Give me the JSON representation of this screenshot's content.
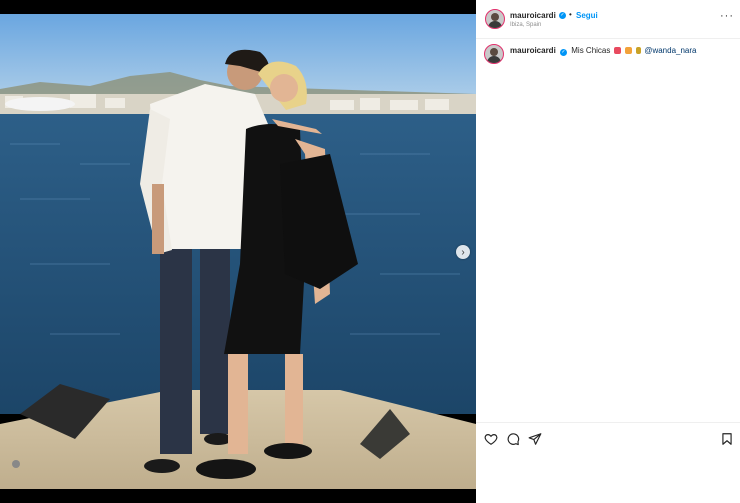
{
  "post": {
    "photo_alt": "Couple kissing on a pier by the sea at sunset",
    "next_icon": "chevron-right-icon",
    "next_glyph": "›"
  },
  "header": {
    "username": "mauroicardi",
    "verified_glyph": "✓",
    "separator": "•",
    "follow_label": "Segui",
    "location": "Ibiza, Spain",
    "more_glyph": "···"
  },
  "caption": {
    "username": "mauroicardi",
    "text": "Mis Chicas",
    "mention": "@wanda_nara",
    "emoji_colors": [
      "#e84a5f",
      "#f2a23a",
      "#c9a227"
    ]
  },
  "actions": {
    "like_icon": "heart-icon",
    "comment_icon": "comment-icon",
    "share_icon": "share-icon",
    "save_icon": "bookmark-icon"
  },
  "colors": {
    "accent": "#0095f6",
    "mention": "#00376b",
    "text": "#262626",
    "muted": "#8e8e8e"
  }
}
